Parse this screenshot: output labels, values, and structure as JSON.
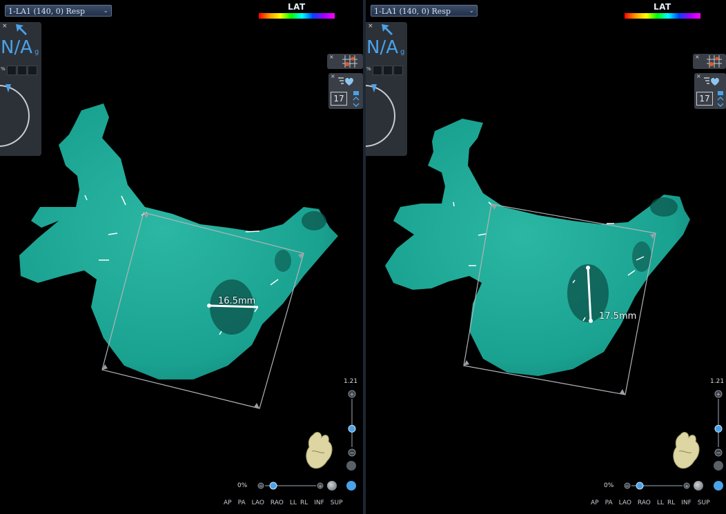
{
  "map_selector": "1-LA1 (140, 0) Resp",
  "lat_label": "LAT",
  "catheter": {
    "close": "×",
    "value": "N/A",
    "unit": "g",
    "percent": "%"
  },
  "tools": {
    "close": "×",
    "electrode_count": "17"
  },
  "panels": [
    {
      "measurement": "16.5mm",
      "zoom": "1.21",
      "zoom_level": 0.38,
      "opacity": "0%"
    },
    {
      "measurement": "17.5mm",
      "zoom": "1.21",
      "zoom_level": 0.38,
      "opacity": "0%"
    }
  ],
  "view_buttons": [
    "AP",
    "PA",
    "LAO",
    "RAO",
    "LL",
    "RL",
    "INF",
    "SUP"
  ],
  "colors": {
    "anatomy": "#1fa594",
    "background": "#000000",
    "accent": "#4aa2e8"
  }
}
